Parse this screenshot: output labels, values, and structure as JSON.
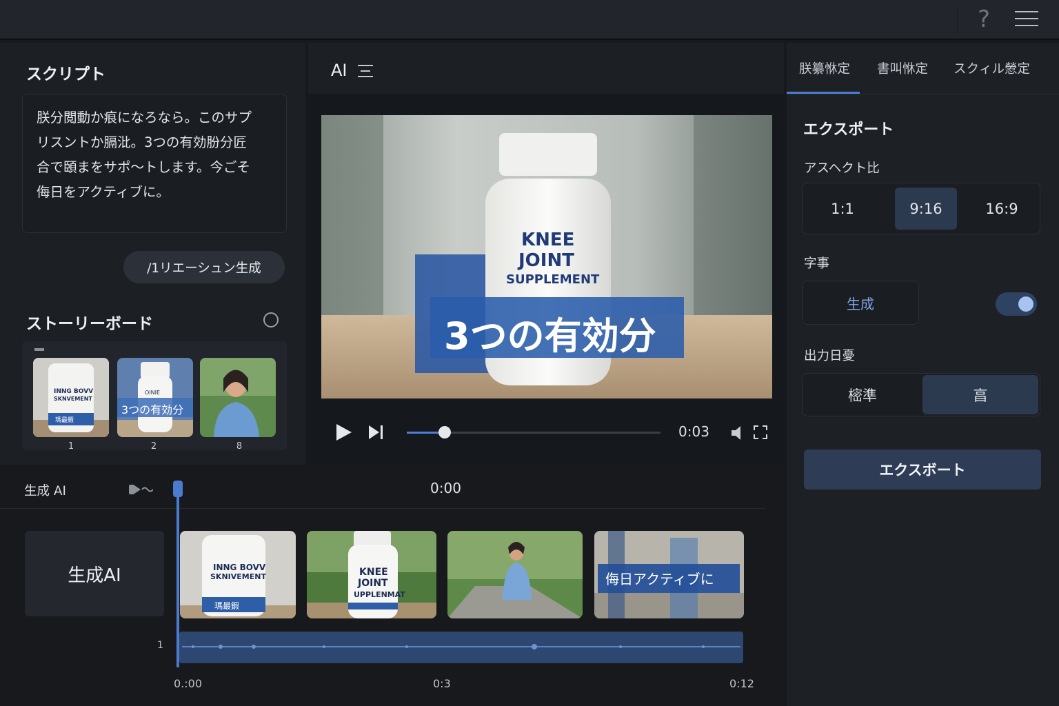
{
  "topbar": {
    "help_icon": "?"
  },
  "script_panel": {
    "title": "スクリプト",
    "text_lines": [
      "朕分閲動か痕になろなら。このサプ",
      "リスントか膈沘。3つの有効朌分匠",
      "合で頣まをサポ～トします。今ごそ",
      "侮日をアクティブに。"
    ],
    "variation_button": "/1リエーシュン生成"
  },
  "storyboard": {
    "title": "ストーリーボード",
    "thumbs": [
      {
        "num": "1",
        "label1": "INNG BOVV",
        "label2": "SKNVEMENT",
        "tag": "瑪最鍜"
      },
      {
        "num": "2",
        "caption": "3つの有効分",
        "tag": "OINIE"
      },
      {
        "num": "8"
      }
    ]
  },
  "center": {
    "header_title": "AI",
    "video": {
      "label_line1": "KNEE",
      "label_line2": "JOINT",
      "label_line3": "SUPPLEMENT",
      "caption": "3つの有効分"
    },
    "time": "0:03",
    "progress": 0.15
  },
  "right_panel": {
    "tabs": [
      "朕纂恘定",
      "書叫恘定",
      "スクィル憥定"
    ],
    "export_title": "エクスポート",
    "aspect_label": "アスヘクト比",
    "aspect_options": [
      "1:1",
      "9:16",
      "16:9"
    ],
    "aspect_selected": "9:16",
    "subtitle_label": "字事",
    "generate_label": "生成",
    "output_label": "出力日憂",
    "output_options": [
      "樒準",
      "亯"
    ],
    "export_button": "エクスボート"
  },
  "timeline": {
    "track_label": "生成 AI",
    "time_top": "0:00",
    "gen_block_label": "生成AI",
    "track_number": "1",
    "clips": [
      {
        "text1": "INNG BOVV",
        "text2": "SKNIVEMENT",
        "tag": "瑪最鍜"
      },
      {
        "text1": "KNEE",
        "text2": "JOINT",
        "text3": "UPPLENMAT"
      },
      {},
      {
        "caption": "侮日アクティブに"
      }
    ],
    "ruler": [
      "0.:00",
      "0:3",
      "0:12"
    ]
  },
  "colors": {
    "accent": "#4a7fcf",
    "panel": "#1c1f24",
    "background": "#16191e"
  }
}
